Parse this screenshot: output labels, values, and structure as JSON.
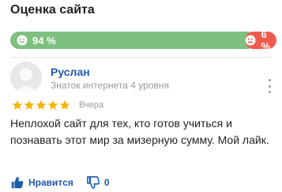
{
  "rating": {
    "title": "Оценка сайта",
    "positive_label": "94 %",
    "negative_label": "6 %",
    "positive_fraction": 0.94,
    "colors": {
      "positive": "#7ec07f",
      "negative": "#ee5b4c"
    }
  },
  "review": {
    "author": "Руслан",
    "author_level": "Знаток интернета 4 уровня",
    "stars": 5,
    "date": "Вчера",
    "text": "Неплохой сайт для тех, кто готов учиться и познавать этот мир за мизерную сумму. Мой лайк.",
    "like_label": "Нравится",
    "dislike_count": "0",
    "icons": [
      "happy-face-icon",
      "sad-face-icon",
      "star-icon",
      "more-vertical-icon",
      "thumbs-up-icon",
      "thumbs-down-icon"
    ]
  }
}
